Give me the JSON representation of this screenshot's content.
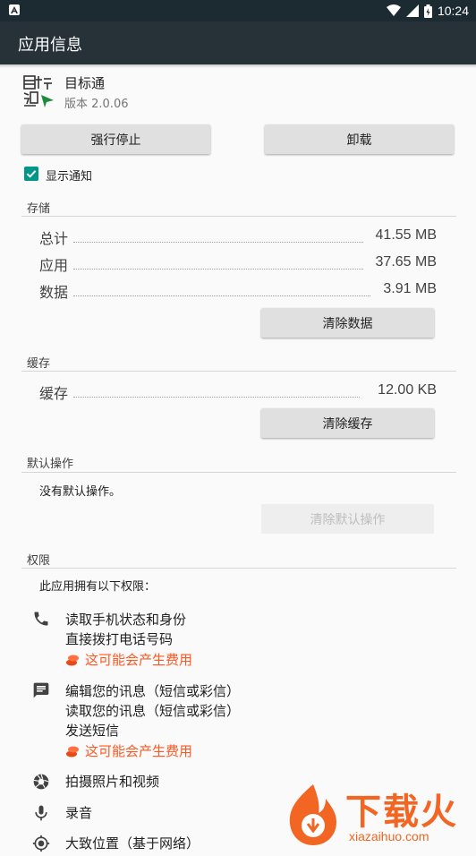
{
  "status_bar": {
    "time": "10:24"
  },
  "app_bar": {
    "title": "应用信息"
  },
  "app": {
    "name": "目标通",
    "version": "版本 2.0.06"
  },
  "buttons": {
    "force_stop": "强行停止",
    "uninstall": "卸载"
  },
  "notifications": {
    "label": "显示通知",
    "checked": true
  },
  "storage": {
    "header": "存储",
    "rows": [
      {
        "label": "总计",
        "value": "41.55 MB"
      },
      {
        "label": "应用",
        "value": "37.65 MB"
      },
      {
        "label": "数据",
        "value": "3.91 MB"
      }
    ],
    "clear_button": "清除数据"
  },
  "cache": {
    "header": "缓存",
    "row": {
      "label": "缓存",
      "value": "12.00 KB"
    },
    "clear_button": "清除缓存"
  },
  "defaults": {
    "header": "默认操作",
    "text": "没有默认操作。",
    "clear_button": "清除默认操作"
  },
  "permissions": {
    "header": "权限",
    "intro": "此应用拥有以下权限：",
    "groups": [
      {
        "icon": "phone-icon",
        "lines": [
          "读取手机状态和身份",
          "直接拨打电话号码"
        ],
        "cost": "这可能会产生费用"
      },
      {
        "icon": "message-icon",
        "lines": [
          "编辑您的讯息（短信或彩信）",
          "读取您的讯息（短信或彩信）",
          "发送短信"
        ],
        "cost": "这可能会产生费用"
      },
      {
        "icon": "camera-icon",
        "lines": [
          "拍摄照片和视频"
        ]
      },
      {
        "icon": "microphone-icon",
        "lines": [
          "录音"
        ]
      },
      {
        "icon": "location-icon",
        "lines": [
          "大致位置（基于网络）"
        ]
      }
    ]
  },
  "watermark": {
    "text": "下载火",
    "url": "xiazaihuo.com"
  },
  "colors": {
    "app_bar": "#263238",
    "status_bar": "#1c2a32",
    "accent": "#009688",
    "cost": "#ff5722",
    "watermark": "#f26522"
  }
}
